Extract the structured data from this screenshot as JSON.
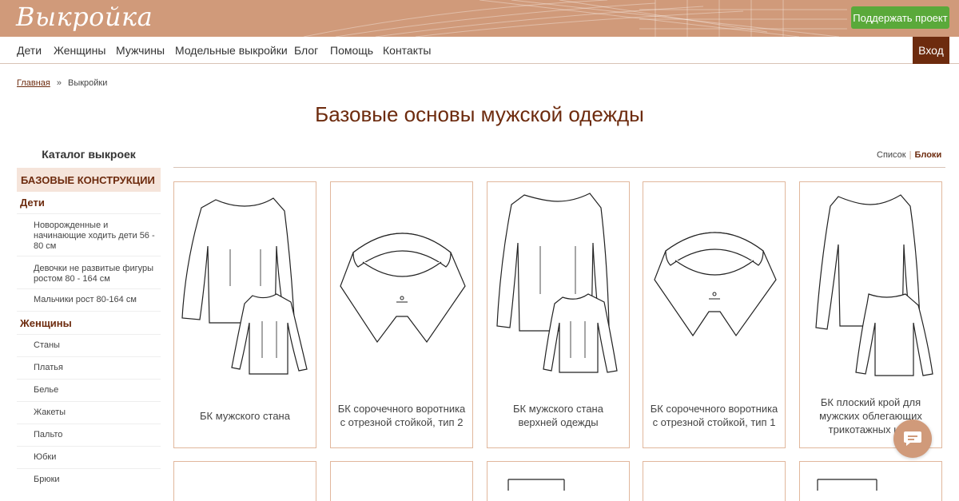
{
  "header": {
    "logo": "Выкройка",
    "support_label": "Поддержать проект"
  },
  "nav": {
    "items": [
      "Дети",
      "Женщины",
      "Мужчины",
      "Модельные выкройки",
      "Блог",
      "Помощь",
      "Контакты"
    ],
    "login_label": "Вход"
  },
  "breadcrumb": {
    "home": "Главная",
    "separator": "»",
    "current": "Выкройки"
  },
  "page": {
    "title": "Базовые основы мужской одежды"
  },
  "sidebar": {
    "title": "Каталог выкроек",
    "section": "БАЗОВЫЕ КОНСТРУКЦИИ",
    "groups": [
      {
        "name": "Дети",
        "items": [
          "Новорожденные и начинающие ходить дети 56 - 80 см",
          "Девочки не развитые фигуры ростом 80 - 164 см",
          "Мальчики рост 80-164 см"
        ]
      },
      {
        "name": "Женщины",
        "items": [
          "Станы",
          "Платья",
          "Белье",
          "Жакеты",
          "Пальто",
          "Юбки",
          "Брюки"
        ]
      }
    ]
  },
  "view_toggle": {
    "list": "Список",
    "separator": "|",
    "blocks": "Блоки"
  },
  "products": [
    {
      "caption": "БК мужского стана",
      "icon": "shirt-bodice-icon"
    },
    {
      "caption": "БК сорочечного воротника с отрезной стойкой, тип 2",
      "icon": "collar-icon"
    },
    {
      "caption": "БК мужского стана верхней одежды",
      "icon": "shirt-bodice-icon"
    },
    {
      "caption": "БК сорочечного воротника с отрезной стойкой, тип 1",
      "icon": "collar-icon"
    },
    {
      "caption": "БК плоский крой для мужских облегающих трикотажных из...",
      "icon": "shirt-bodice-icon"
    }
  ],
  "colors": {
    "banner": "#d09a7a",
    "accent": "#6d2b0e",
    "support_button": "#5aa93a",
    "card_border": "#e1b79c",
    "section_bg": "#f5e4da"
  }
}
